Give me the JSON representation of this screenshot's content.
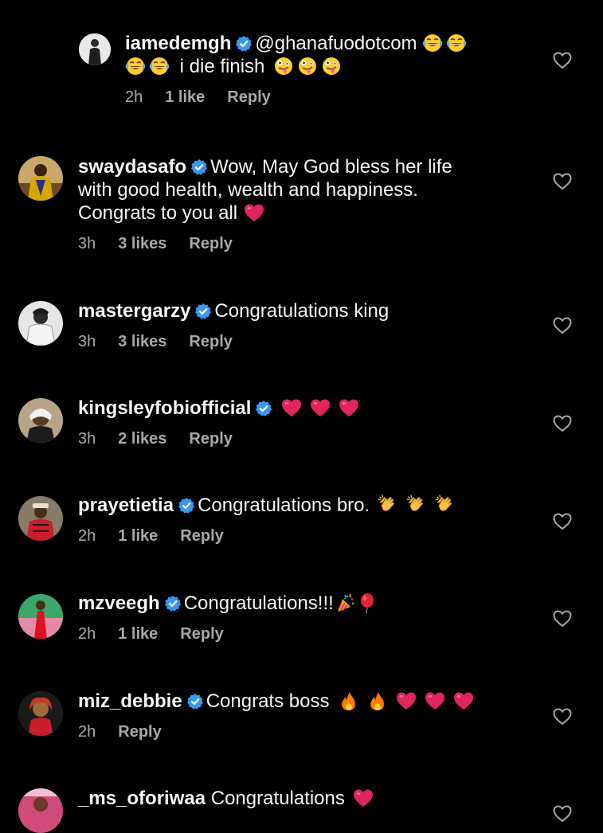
{
  "comments": [
    {
      "username": "iamedemgh",
      "verified": true,
      "text_before": "@ghanafuodotcom",
      "emoji_line1": [
        "laughing-tears",
        "laughing-tears"
      ],
      "line2_emoji": [
        "laughing-tears",
        "laughing-tears"
      ],
      "text_after": "i die finish",
      "emoji_after": [
        "zany-face",
        "zany-face",
        "zany-face"
      ],
      "time": "2h",
      "likes": "1 like",
      "reply": "Reply"
    },
    {
      "username": "swaydasafo",
      "verified": true,
      "text": "Wow, May God bless her life",
      "text_line2": "with good health, wealth and happiness.",
      "text_line3": "Congrats to you all",
      "emoji": [
        "red-heart"
      ],
      "time": "3h",
      "likes": "3 likes",
      "reply": "Reply"
    },
    {
      "username": "mastergarzy",
      "verified": true,
      "text": "Congratulations king",
      "time": "3h",
      "likes": "3 likes",
      "reply": "Reply"
    },
    {
      "username": "kingsleyfobiofficial",
      "verified": true,
      "text": "",
      "emoji": [
        "red-heart",
        "red-heart",
        "red-heart"
      ],
      "time": "3h",
      "likes": "2 likes",
      "reply": "Reply"
    },
    {
      "username": "prayetietia",
      "verified": true,
      "text": "Congratulations bro.",
      "emoji": [
        "clapping-hands",
        "clapping-hands",
        "clapping-hands"
      ],
      "time": "2h",
      "likes": "1 like",
      "reply": "Reply"
    },
    {
      "username": "mzveegh",
      "verified": true,
      "text": "Congratulations!!!",
      "emoji": [
        "party-popper",
        "balloon"
      ],
      "time": "2h",
      "likes": "1 like",
      "reply": "Reply"
    },
    {
      "username": "miz_debbie",
      "verified": true,
      "text": "Congrats boss",
      "emoji": [
        "fire",
        "fire",
        "red-heart",
        "red-heart",
        "red-heart"
      ],
      "time": "2h",
      "likes": "",
      "reply": "Reply"
    },
    {
      "username": "_ms_oforiwaa",
      "verified": false,
      "text": "Congratulations",
      "emoji": [
        "red-heart"
      ]
    }
  ],
  "colors": {
    "background": "#000000",
    "text": "#f5f5f5",
    "meta": "#a8a8a8",
    "verified": "#3897f0",
    "heart": "#e0245e"
  },
  "icons": {
    "like": "heart-outline-icon",
    "verified": "verified-badge-icon"
  }
}
